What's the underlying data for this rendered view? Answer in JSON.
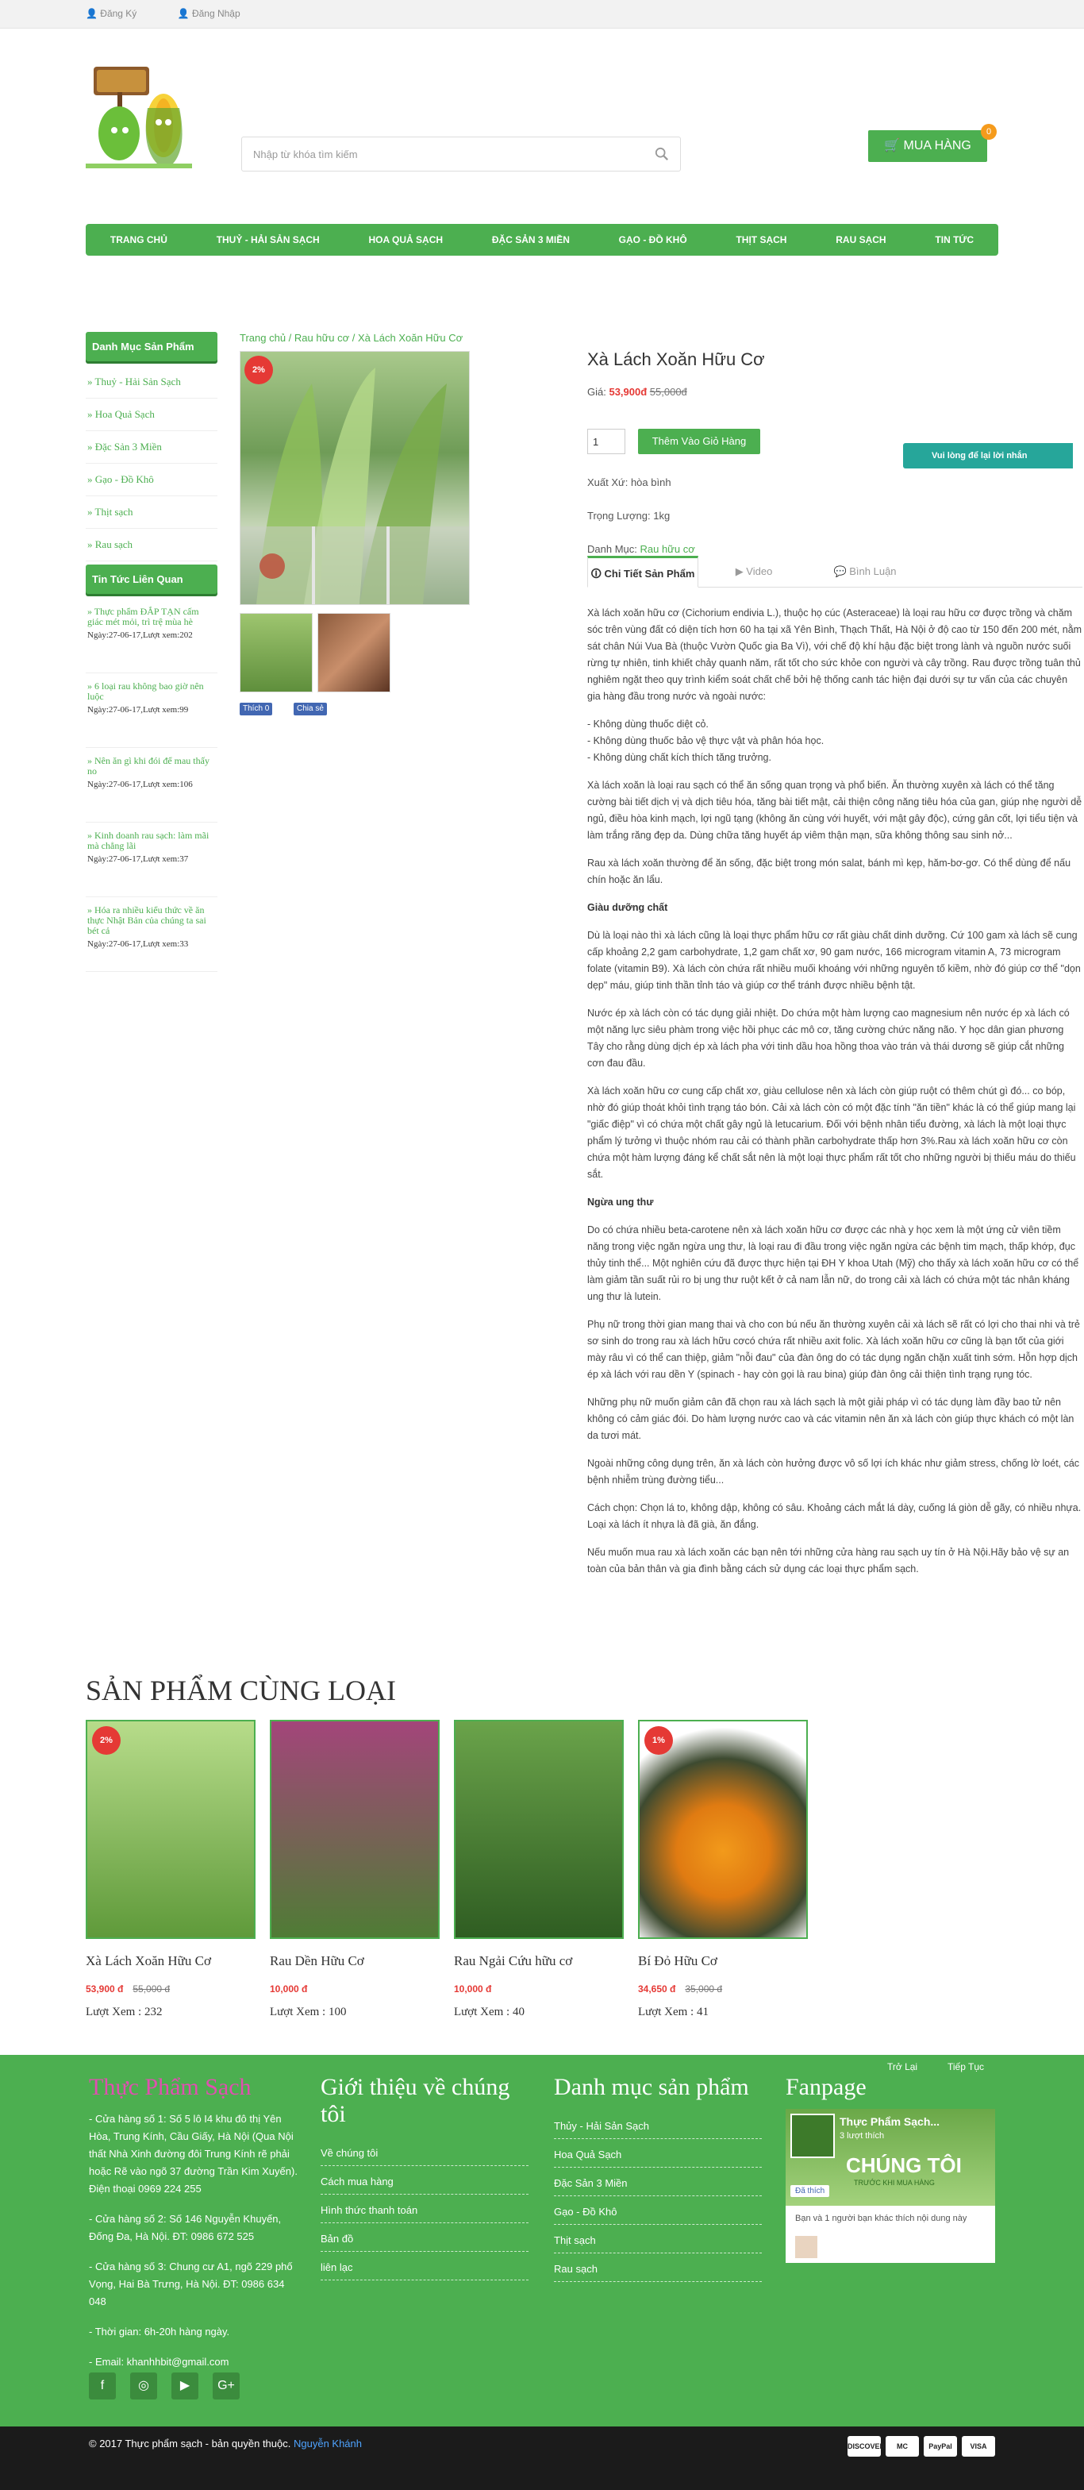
{
  "topbar": {
    "register": "Đăng Ký",
    "login": "Đăng Nhập"
  },
  "search": {
    "placeholder": "Nhập từ khóa tìm kiếm"
  },
  "cart": {
    "label": "MUA HÀNG",
    "count": "0"
  },
  "nav": [
    "TRANG CHỦ",
    "THUỶ - HẢI SẢN SẠCH",
    "HOA QUẢ SẠCH",
    "ĐẶC SẢN 3 MIỀN",
    "GẠO - ĐỒ KHÔ",
    "THỊT SẠCH",
    "RAU SẠCH",
    "TIN TỨC"
  ],
  "sidebar": {
    "category_title": "Danh Mục Sản Phẩm",
    "categories": [
      "» Thuỷ - Hải Sản Sạch",
      "» Hoa Quả Sạch",
      "» Đặc Sản 3 Miền",
      "» Gạo - Đồ Khô",
      "» Thịt sạch",
      "» Rau sạch"
    ],
    "news_title": "Tin Tức Liên Quan",
    "news": [
      {
        "title": "» Thực phẩm ĐẮP TẠN cấm giác mét mỏi, trì trệ mùa hè",
        "meta": "Ngày:27-06-17,Lượt xem:202"
      },
      {
        "title": "» 6 loại rau không bao giờ nên luộc",
        "meta": "Ngày:27-06-17,Lượt xem:99"
      },
      {
        "title": "» Nên ăn gì khi đói để mau thấy no",
        "meta": "Ngày:27-06-17,Lượt xem:106"
      },
      {
        "title": "» Kinh doanh rau sạch: làm mãi mà chẳng lãi",
        "meta": "Ngày:27-06-17,Lượt xem:37"
      },
      {
        "title": "» Hóa ra nhiều kiểu thức về ăn thực Nhật Bản của chúng ta sai bét cả",
        "meta": "Ngày:27-06-17,Lượt xem:33"
      }
    ]
  },
  "breadcrumb": {
    "home": "Trang chủ",
    "sep": " / ",
    "cat": "Rau hữu cơ",
    "current": "Xà Lách Xoăn Hữu Cơ"
  },
  "product": {
    "badge": "2%",
    "title": "Xà Lách Xoăn Hữu Cơ",
    "price_label": "Giá: ",
    "price": "53,900đ",
    "old_price": "55,000đ",
    "qty": "1",
    "add_cart": "Thêm Vào Giỏ Hàng",
    "origin": "Xuất Xứ: hòa bình",
    "weight": "Trọng Lượng: 1kg",
    "category_label": "Danh Mục: ",
    "category": "Rau hữu cơ",
    "like": "Thích 0",
    "share": "Chia sẻ"
  },
  "tabs": [
    "Chi Tiết Sản Phẩm",
    "Video",
    "Bình Luận"
  ],
  "chat": "Vui lòng để lại lời nhắn",
  "description": [
    "Xà lách xoăn hữu cơ (Cichorium endivia L.), thuộc họ cúc (Asteraceae) là loại rau hữu cơ được trồng và chăm sóc trên vùng đất có diện tích hơn 60 ha tại xã Yên Bình, Thạch Thất, Hà Nội ở độ cao từ 150 đến 200 mét, nằm sát chân Núi Vua Bà (thuộc Vườn Quốc gia Ba Vì), với chế độ khí hậu đặc biệt trong lành và nguồn nước suối rừng tự nhiên, tinh khiết chảy quanh năm, rất tốt cho sức khỏe con người và cây trồng. Rau được trồng tuân thủ nghiêm ngặt theo quy trình kiểm soát chất chế bởi hệ thống canh tác hiện đại dưới sự tư vấn của các chuyên gia hàng đầu trong nước và ngoài nước:",
    "- Không dùng thuốc diệt cỏ.\n- Không dùng thuốc bảo vệ thực vật và phân hóa học.\n- Không dùng chất kích thích tăng trưởng.",
    "Xà lách xoăn là loại rau sạch có thể ăn sống quan trọng và phổ biến. Ăn thường xuyên xà lách có thể tăng cường bài tiết dịch vị và dịch tiêu hóa, tăng bài tiết mật, cải thiện công năng tiêu hóa của gan, giúp nhẹ người dễ ngủ, điều hòa kinh mạch, lợi ngũ tạng (không ăn cùng với huyết, với mật gây độc), cứng gân cốt, lợi tiểu tiện và làm trắng răng đẹp da. Dùng chữa tăng huyết áp viêm thận mạn, sữa không thông sau sinh nở...",
    "Rau xà lách xoăn thường để ăn sống, đặc biệt trong món salat, bánh mì kẹp, hăm-bơ-gơ. Có thể dùng để nấu chín hoặc ăn lẩu.",
    "Giàu dưỡng chất",
    "Dù là loại nào thì xà lách cũng là loại thực phẩm hữu cơ rất giàu chất dinh dưỡng. Cứ 100 gam xà lách sẽ cung cấp khoảng 2,2 gam carbohydrate, 1,2 gam chất xơ, 90 gam nước, 166 microgram vitamin A, 73 microgram folate (vitamin B9). Xà lách còn chứa rất nhiều muối khoáng với những nguyên tố kiềm, nhờ đó giúp cơ thể \"dọn dẹp\" máu, giúp tinh thần tỉnh táo và giúp cơ thể tránh được nhiều bệnh tật.",
    "Nước ép xà lách còn có tác dụng giải nhiệt. Do chứa một hàm lượng cao magnesium nên nước ép xà lách có một năng lực siêu phàm trong việc hồi phục các mô cơ, tăng cường chức năng não. Y học dân gian phương Tây cho rằng dùng dịch ép xà lách pha với tinh dầu hoa hồng thoa vào trán và thái dương sẽ giúp cắt những cơn đau đầu.",
    "Xà lách xoăn hữu cơ cung cấp chất xơ, giàu cellulose nên xà lách còn giúp ruột có thêm chút gì đó... co bóp, nhờ đó giúp thoát khỏi tình trạng táo bón. Cải xà lách còn có một đặc tính \"ăn tiền\" khác là có thể giúp mang lại \"giấc điệp\" vì có chứa một chất gây ngủ là letucarium. Đối với bệnh nhân tiểu đường, xà lách là một loại thực phẩm lý tưởng vì thuộc nhóm rau cải có thành phần carbohydrate thấp hơn 3%.Rau xà lách xoăn hữu cơ còn chứa một hàm lượng đáng kể chất sắt nên là một loại thực phẩm rất tốt cho những người bị thiếu máu do thiếu sắt.",
    "Ngừa ung thư",
    "Do có chứa nhiều beta-carotene nên xà lách xoăn hữu cơ được các nhà y học xem là một ứng cử viên tiềm năng trong việc ngăn ngừa ung thư, là loại rau đi đầu trong việc ngăn ngừa các bệnh tim mạch, thấp khớp, đục thủy tinh thể... Một nghiên cứu đã được thực hiện tại ĐH Y khoa Utah (Mỹ) cho thấy xà lách xoăn hữu cơ có thể làm giảm tần suất rủi ro bị ung thư ruột kết ở cả nam lẫn nữ, do trong cải xà lách có chứa một tác nhân kháng ung thư là lutein.",
    "Phụ nữ trong thời gian mang thai và cho con bú nếu ăn thường xuyên cải xà lách sẽ rất có lợi cho thai nhi và trẻ sơ sinh do trong rau xà lách hữu cơcó chứa rất nhiều axit folic. Xà lách xoăn hữu cơ cũng là bạn tốt của giới mày râu vì có thể can thiệp, giảm \"nỗi đau\" của đàn ông do có tác dụng ngăn chặn xuất tinh sớm. Hỗn hợp dịch ép xà lách với rau dền Y (spinach - hay còn gọi là rau bina) giúp đàn ông cải thiện tình trạng rụng tóc.",
    "Những phụ nữ muốn giảm cân đã chọn rau xà lách sạch là một giải pháp vì có tác dụng làm đầy bao tử nên không có cảm giác đói. Do hàm lượng nước cao và các vitamin nên ăn xà lách còn giúp thực khách có một làn da tươi mát.",
    "Ngoài những công dụng trên, ăn xà lách còn hưởng được vô số lợi ích khác như giảm stress, chống lờ loét, các bệnh nhiễm trùng đường tiểu...",
    "Cách chọn: Chọn lá to, không dập, không có sâu. Khoảng cách mắt lá dày, cuống lá giòn dễ gãy, có nhiều nhựa. Loại xà lách ít nhựa là đã già, ăn đắng.",
    "Nếu muốn mua rau xà lách xoăn các bạn nên tới những cửa hàng rau sạch uy tín ở Hà Nội.Hãy bảo vệ sự an toàn của bản thân và gia đình bằng cách sử dụng các loại thực phẩm sạch."
  ],
  "related": {
    "title": "SẢN PHẨM CÙNG LOẠI",
    "items": [
      {
        "name": "Xà Lách Xoăn Hữu Cơ",
        "price": "53,900 đ",
        "old": "55,000 đ",
        "views": "Lượt Xem : 232",
        "badge": "2%"
      },
      {
        "name": "Rau Dền Hữu Cơ",
        "price": "10,000 đ",
        "old": "",
        "views": "Lượt Xem : 100",
        "badge": ""
      },
      {
        "name": "Rau Ngải Cứu hữu cơ",
        "price": "10,000 đ",
        "old": "",
        "views": "Lượt Xem : 40",
        "badge": ""
      },
      {
        "name": "Bí Đỏ Hữu Cơ",
        "price": "34,650 đ",
        "old": "35,000 đ",
        "views": "Lượt Xem : 41",
        "badge": "1%"
      }
    ]
  },
  "footer": {
    "brand": "Thực Phẩm Sạch",
    "address": [
      "- Cửa hàng số 1: Số 5 lô I4 khu đô thị Yên Hòa, Trung Kính, Cầu Giấy, Hà Nội (Qua Nội thất Nhà Xinh đường đôi Trung Kính rẽ phải hoặc Rẽ vào ngõ 37 đường Trần Kim Xuyến). Điện thoại 0969 224 255",
      "- Cửa hàng số 2: Số 146 Nguyễn Khuyến, Đống Đa, Hà Nội. ĐT: 0986 672 525",
      "- Cửa hàng số 3: Chung cư A1, ngõ 229 phố Vọng, Hai Bà Trưng, Hà Nội. ĐT: 0986 634 048",
      "- Thời gian: 6h-20h hàng ngày.",
      "- Email: khanhhbit@gmail.com"
    ],
    "about_title": "Giới thiệu về chúng tôi",
    "about_links": [
      "Về chúng tôi",
      "Cách mua hàng",
      "Hình thức thanh toán",
      "Bản đồ",
      "liên lạc"
    ],
    "cat_title": "Danh mục sản phẩm",
    "cat_links": [
      "Thủy - Hải Sản Sạch",
      "Hoa Quả Sạch",
      "Đặc Sản 3 Miền",
      "Gạo - Đồ Khô",
      "Thịt sạch",
      "Rau sạch"
    ],
    "fanpage_title": "Fanpage",
    "back": "Trở Lại",
    "next": "Tiếp Tục",
    "fb_page": "Thực Phẩm Sạch...",
    "fb_likes": "3 lượt thích",
    "fb_banner": "CHÚNG TÔI",
    "fb_sub": "TRƯỚC KHI MUA HÀNG",
    "fb_like_btn": "Đã thích",
    "fb_friend": "Bạn và 1 người bạn khác thích nội dung này",
    "social": [
      "f",
      "◎",
      "▶",
      "G+"
    ]
  },
  "copyright": {
    "text": "© 2017 Thực phẩm sạch - bản quyền thuộc. ",
    "author": "Nguyễn Khánh",
    "cards": [
      "DISCOVER",
      "MC",
      "PayPal",
      "VISA"
    ]
  }
}
